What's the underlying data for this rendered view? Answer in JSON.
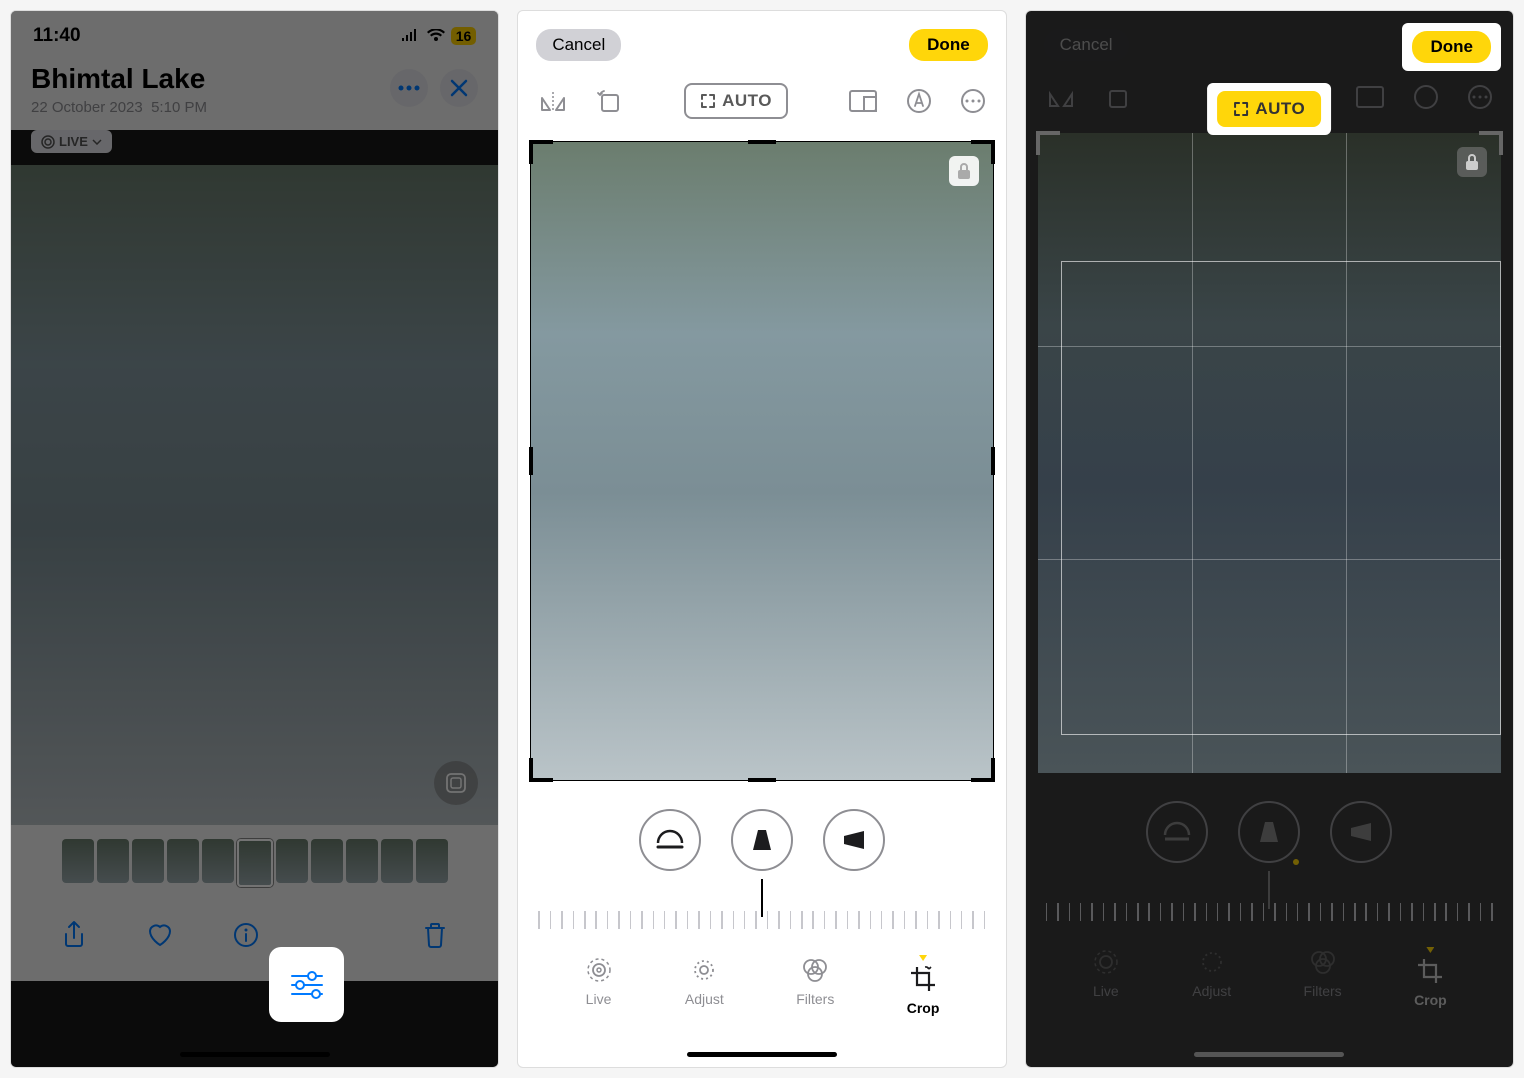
{
  "panel1": {
    "status": {
      "time": "11:40",
      "battery": "16"
    },
    "title": "Bhimtal Lake",
    "date": "22 October 2023",
    "time": "5:10 PM",
    "live_label": "LIVE"
  },
  "panel2": {
    "cancel": "Cancel",
    "done": "Done",
    "auto": "AUTO",
    "modes": {
      "live": "Live",
      "adjust": "Adjust",
      "filters": "Filters",
      "crop": "Crop"
    }
  },
  "panel3": {
    "cancel": "Cancel",
    "done": "Done",
    "auto": "AUTO",
    "modes": {
      "live": "Live",
      "adjust": "Adjust",
      "filters": "Filters",
      "crop": "Crop"
    }
  }
}
